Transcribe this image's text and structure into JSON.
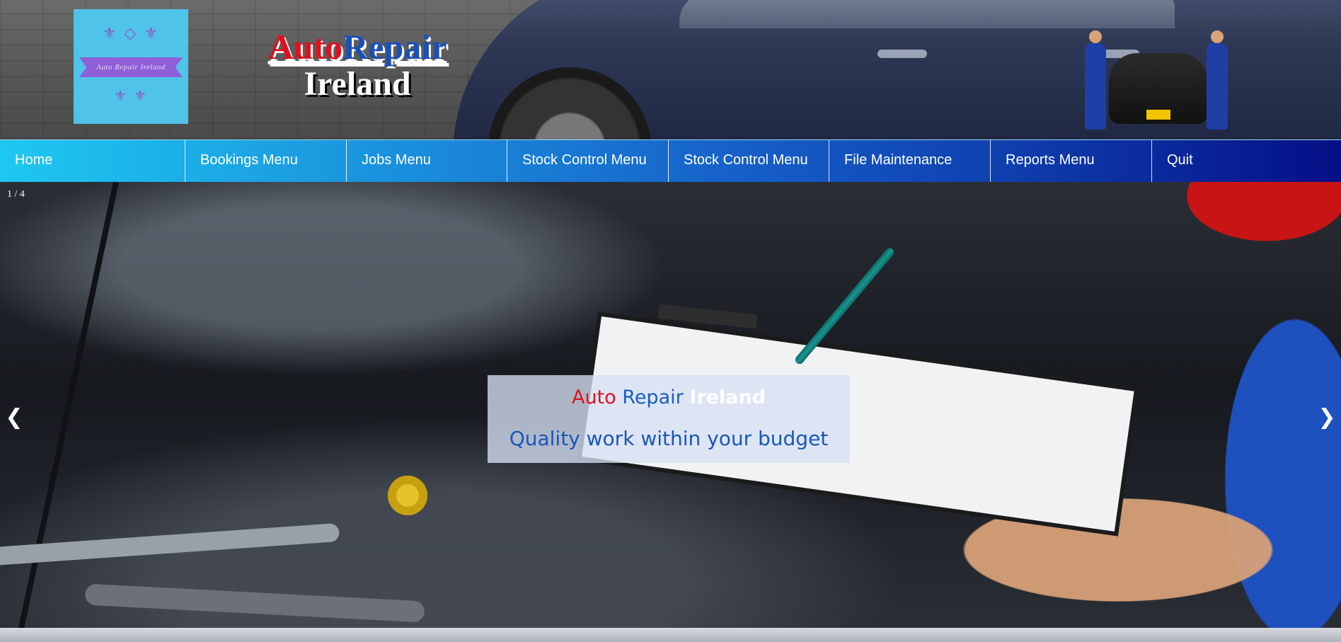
{
  "header": {
    "logo": {
      "text": "Auto Repair Ireland",
      "ornament": "⚜ ◇ ⚜",
      "ornament_bottom": "⚜ ⚜"
    },
    "brand": {
      "word1": "Auto",
      "word2": "Repair",
      "line2": "Ireland"
    }
  },
  "nav": {
    "items": [
      {
        "label": "Home"
      },
      {
        "label": "Bookings Menu"
      },
      {
        "label": "Jobs Menu"
      },
      {
        "label": "Stock Control Menu"
      },
      {
        "label": "Stock Control Menu"
      },
      {
        "label": "File Maintenance"
      },
      {
        "label": "Reports Menu"
      },
      {
        "label": "Quit"
      }
    ]
  },
  "slideshow": {
    "counter": "1 / 4",
    "prev_icon": "❮",
    "next_icon": "❯",
    "caption": {
      "title_auto": "Auto",
      "title_repair": "Repair",
      "title_ireland": "Ireland",
      "subtitle": "Quality work within your budget"
    }
  },
  "colors": {
    "brand_red": "#e0111f",
    "brand_blue": "#1b4fb8",
    "nav_start": "#1ec8f0",
    "nav_end": "#050f86",
    "logo_bg": "#4fc3e8",
    "logo_ribbon": "#8e5fd6"
  }
}
